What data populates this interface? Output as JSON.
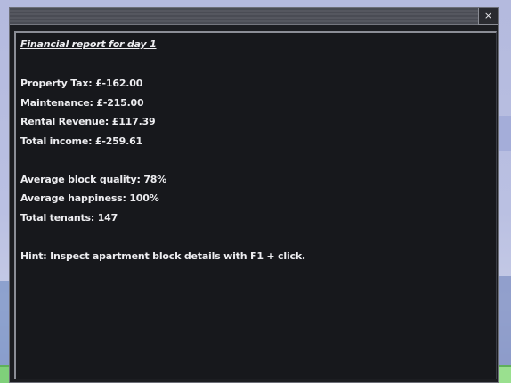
{
  "window": {
    "close_label": "×"
  },
  "report": {
    "title": "Financial report for day 1",
    "property_tax": "Property Tax: £-162.00",
    "maintenance": "Maintenance: £-215.00",
    "rental_revenue": "Rental Revenue: £117.39",
    "total_income": "Total income: £-259.61",
    "avg_block_quality": "Average block quality: 78%",
    "avg_happiness": "Average happiness: 100%",
    "total_tenants": "Total tenants: 147",
    "hint": "Hint: Inspect apartment block details with F1 + click."
  }
}
